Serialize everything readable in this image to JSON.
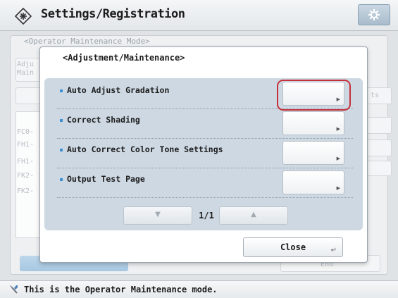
{
  "header": {
    "title": "Settings/Registration",
    "title_icon": "settings-registration-icon",
    "settings_button_icon": "gear-icon"
  },
  "background": {
    "subtitle": "<Operator Maintenance Mode>",
    "labels": [
      "Adju",
      "Main",
      "FC0-",
      "FH1-",
      "FH1-",
      "FK2-",
      "FK2-"
    ],
    "side_fragment": "ts",
    "end_label": "End"
  },
  "dialog": {
    "title": "<Adjustment/Maintenance>",
    "items": [
      {
        "label": "Auto Adjust Gradation"
      },
      {
        "label": "Correct Shading"
      },
      {
        "label": "Auto Correct Color Tone Settings"
      },
      {
        "label": "Output Test Page"
      }
    ],
    "pager": {
      "page_text": "1/1",
      "down_icon": "triangle-down-icon",
      "up_icon": "triangle-up-icon"
    },
    "close_label": "Close"
  },
  "status": {
    "text": "This is the Operator Maintenance mode.",
    "icon": "wrench-icon"
  },
  "colors": {
    "highlight": "#c6303a",
    "panel": "#cdd8e2",
    "bullet": "#3a8fd0"
  }
}
